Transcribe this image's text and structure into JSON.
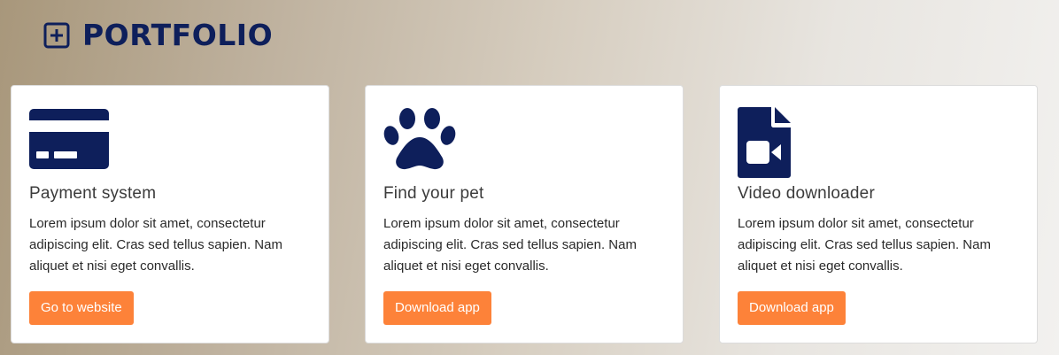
{
  "section": {
    "title": "PORTFOLIO",
    "icon": "plus-square-icon"
  },
  "cards": [
    {
      "icon": "credit-card-icon",
      "title": "Payment system",
      "description": "Lorem ipsum dolor sit amet, consectetur adipiscing elit. Cras sed tellus sapien. Nam aliquet et nisi eget convallis.",
      "button_label": "Go to website"
    },
    {
      "icon": "paw-icon",
      "title": "Find your pet",
      "description": "Lorem ipsum dolor sit amet, consectetur adipiscing elit. Cras sed tellus sapien. Nam aliquet et nisi eget convallis.",
      "button_label": "Download app"
    },
    {
      "icon": "file-video-icon",
      "title": "Video downloader",
      "description": "Lorem ipsum dolor sit amet, consectetur adipiscing elit. Cras sed tellus sapien. Nam aliquet et nisi eget convallis.",
      "button_label": "Download app"
    }
  ],
  "colors": {
    "heading": "#0e1f5b",
    "icon": "#0e1f5b",
    "button": "#fd8239",
    "button_text": "#ffffff"
  }
}
